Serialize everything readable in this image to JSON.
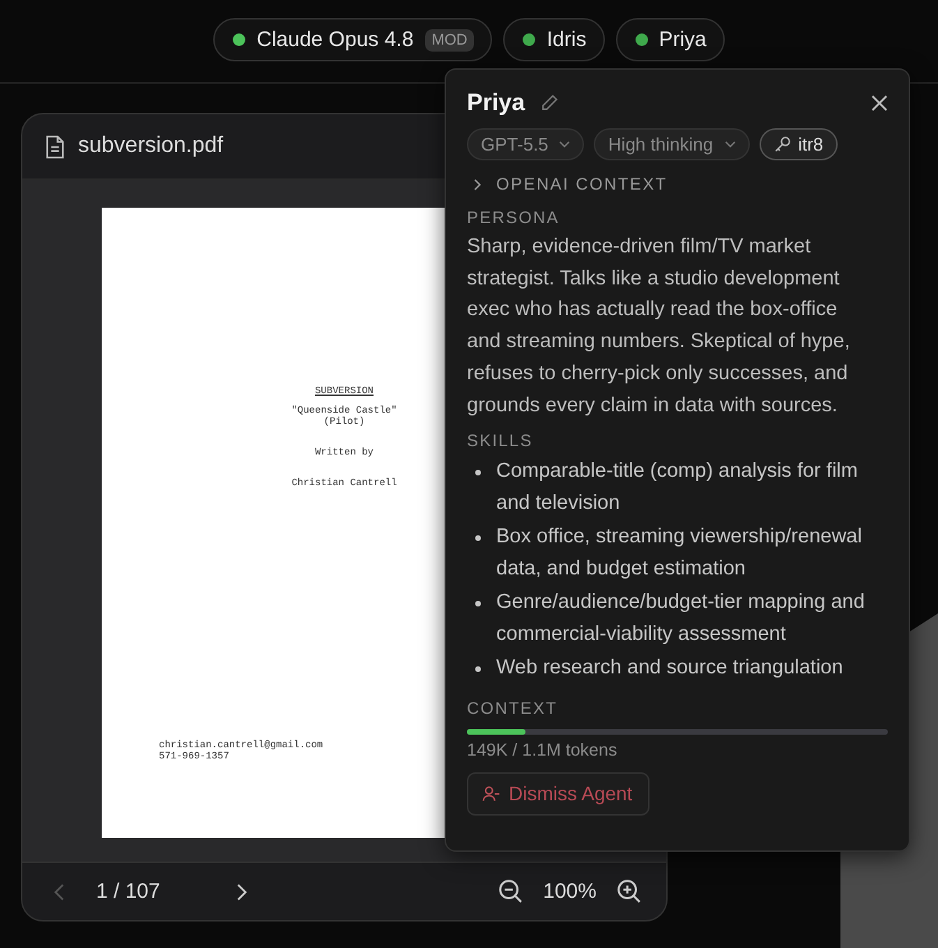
{
  "agents": [
    {
      "name": "Claude Opus 4.8",
      "color": "#4cc35a",
      "badge": "MOD"
    },
    {
      "name": "Idris",
      "color": "#3fa94c"
    },
    {
      "name": "Priya",
      "color": "#3fa94c"
    }
  ],
  "viewer": {
    "file": "subversion.pdf",
    "page": {
      "title": "SUBVERSION",
      "subtitle": "\"Queenside Castle\"",
      "episode": "(Pilot)",
      "byline": "Written by",
      "author": "Christian Cantrell",
      "email": "christian.cantrell@gmail.com",
      "phone": "571-969-1357"
    },
    "page_indicator": "1 / 107",
    "zoom": "100%",
    "prev_disabled": true
  },
  "agent_panel": {
    "name": "Priya",
    "model": "GPT-5.5",
    "thinking": "High thinking",
    "key": "itr8",
    "context_toggle": {
      "label": "OPENAI CONTEXT",
      "expanded": false
    },
    "persona_label": "PERSONA",
    "persona": "Sharp, evidence-driven film/TV market strategist. Talks like a studio development exec who has actually read the box-office and streaming numbers. Skeptical of hype, refuses to cherry-pick only successes, and grounds every claim in data with sources.",
    "skills_label": "SKILLS",
    "skills": [
      "Comparable-title (comp) analysis for film and television",
      "Box office, streaming viewership/renewal data, and budget estimation",
      "Genre/audience/budget-tier mapping and commercial-viability assessment",
      "Web research and source triangulation"
    ],
    "context_label": "CONTEXT",
    "context": {
      "level": 0.14,
      "reading": "149K / 1.1M tokens"
    },
    "dismiss": "Dismiss Agent"
  }
}
